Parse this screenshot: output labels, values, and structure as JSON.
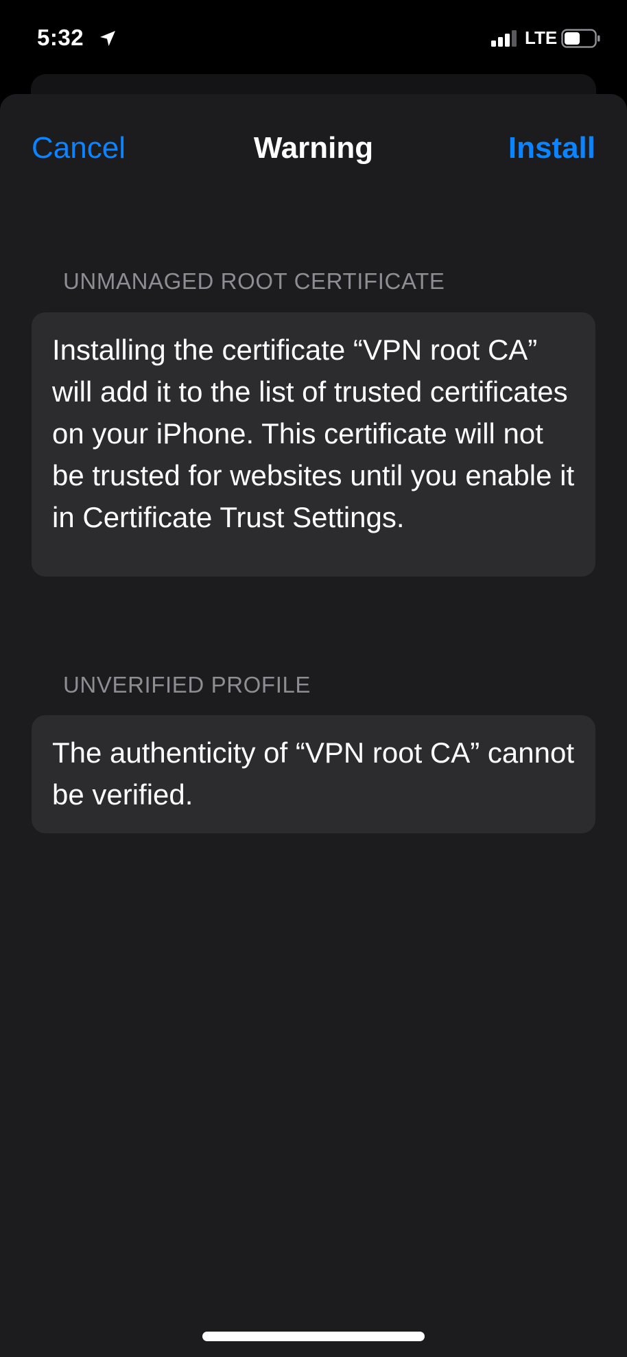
{
  "status_bar": {
    "time": "5:32",
    "network": "LTE",
    "location_icon": "location-arrow-icon",
    "signal_icon": "cellular-signal-icon",
    "battery_icon": "battery-icon"
  },
  "nav": {
    "cancel_label": "Cancel",
    "title": "Warning",
    "install_label": "Install"
  },
  "sections": [
    {
      "header": "UNMANAGED ROOT CERTIFICATE",
      "body": "Installing the certificate “VPN root CA” will add it to the list of trusted certificates on your iPhone. This certificate will not be trusted for websites until you enable it in Certificate Trust Settings."
    },
    {
      "header": "UNVERIFIED PROFILE",
      "body": "The authenticity of “VPN root CA” cannot be verified."
    }
  ],
  "colors": {
    "accent": "#0a84ff",
    "sheet_background": "#1c1c1e",
    "card_background": "#2c2c2e",
    "secondary_text": "#8d8d93"
  }
}
